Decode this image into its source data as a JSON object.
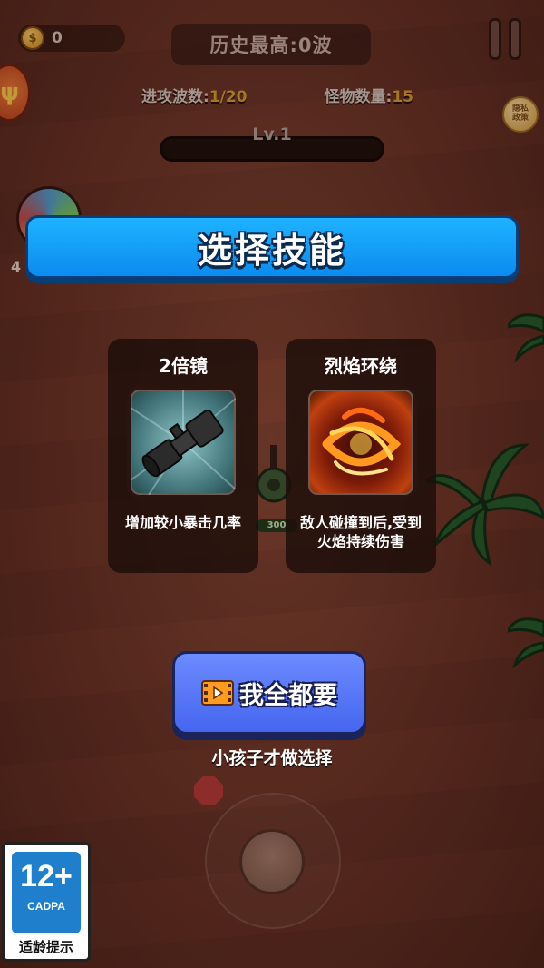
{
  "hud": {
    "coin_count": "0",
    "best_score": "历史最高:0波",
    "wave_label": "进攻波数:",
    "wave_value": "1/20",
    "monster_label": "怪物数量:",
    "monster_value": "15",
    "level": "Lv.1",
    "privacy_line1": "隐私",
    "privacy_line2": "政策",
    "hero_level": "4",
    "turret_hp": "300"
  },
  "dialog": {
    "title": "选择技能",
    "skills": [
      {
        "name": "2倍镜",
        "desc": "增加较小暴击几率",
        "icon": "scope-icon"
      },
      {
        "name": "烈焰环绕",
        "desc": "敌人碰撞到后,受到火焰持续伤害",
        "icon": "flame-ring-icon"
      }
    ],
    "claim_all_label": "我全都要",
    "skip_text": "小孩子才做选择"
  },
  "age_rating": {
    "number": "12+",
    "org": "CADPA",
    "caption": "适龄提示"
  },
  "colors": {
    "banner_blue": "#0a8cf0",
    "button_blue": "#4566ef",
    "accent_gold": "#d8a12d"
  }
}
